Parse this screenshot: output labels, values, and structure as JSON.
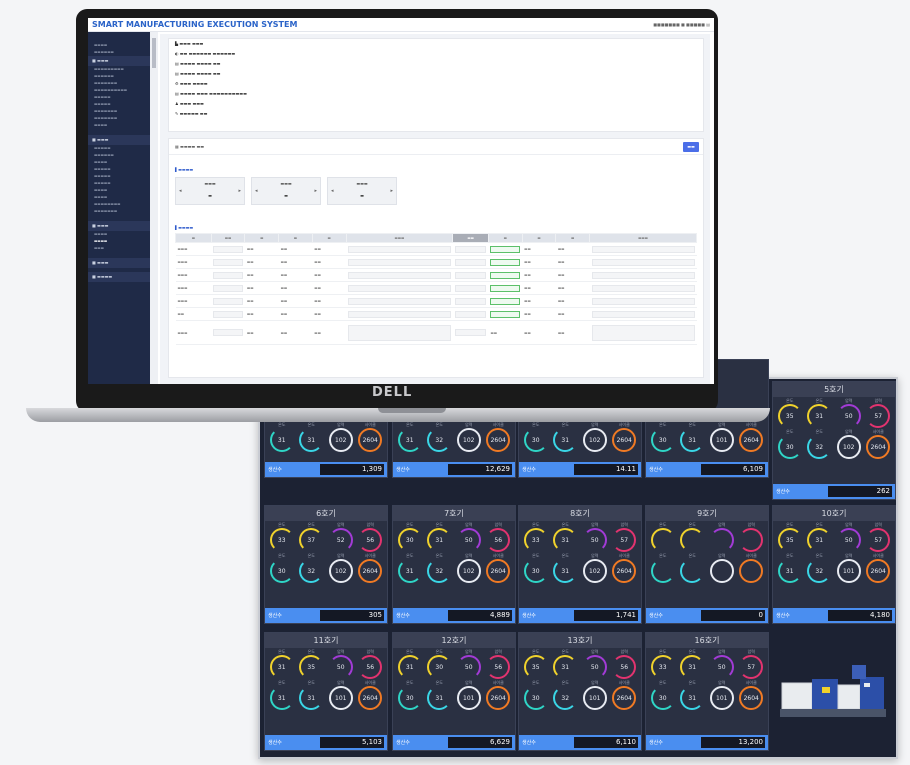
{
  "app": {
    "title": "SMART MANUFACTURING EXECUTION SYSTEM"
  },
  "laptop": {
    "brand": "DELL"
  },
  "machines": [
    {
      "name": "5호기",
      "top": [
        "35",
        "31",
        "50",
        "57"
      ],
      "bottom": [
        "30",
        "32",
        "102",
        "2604"
      ],
      "production": "262"
    },
    {
      "name": "6호기",
      "top": [
        "33",
        "37",
        "52",
        "56"
      ],
      "bottom": [
        "30",
        "32",
        "102",
        "2604"
      ],
      "production": "305"
    },
    {
      "name": "7호기",
      "top": [
        "30",
        "31",
        "50",
        "56"
      ],
      "bottom": [
        "31",
        "32",
        "102",
        "2604"
      ],
      "production": "4,889"
    },
    {
      "name": "8호기",
      "top": [
        "33",
        "31",
        "50",
        "57"
      ],
      "bottom": [
        "30",
        "31",
        "102",
        "2604"
      ],
      "production": "1,741"
    },
    {
      "name": "9호기",
      "top": [
        "",
        "",
        "",
        ""
      ],
      "bottom": [
        "",
        "",
        "",
        ""
      ],
      "production": "0"
    },
    {
      "name": "10호기",
      "top": [
        "35",
        "31",
        "50",
        "57"
      ],
      "bottom": [
        "31",
        "32",
        "101",
        "2604"
      ],
      "production": "4,180"
    },
    {
      "name": "11호기",
      "top": [
        "31",
        "35",
        "50",
        "56"
      ],
      "bottom": [
        "31",
        "31",
        "101",
        "2604"
      ],
      "production": "5,103"
    },
    {
      "name": "12호기",
      "top": [
        "31",
        "30",
        "50",
        "56"
      ],
      "bottom": [
        "30",
        "31",
        "101",
        "2604"
      ],
      "production": "6,629"
    },
    {
      "name": "13호기",
      "top": [
        "35",
        "31",
        "50",
        "56"
      ],
      "bottom": [
        "30",
        "32",
        "101",
        "2604"
      ],
      "production": "6,110"
    },
    {
      "name": "16호기",
      "top": [
        "33",
        "31",
        "50",
        "57"
      ],
      "bottom": [
        "30",
        "31",
        "101",
        "2604"
      ],
      "production": "13,200"
    }
  ],
  "partial_row": [
    {
      "bottom": [
        "31",
        "31",
        "102",
        "2604"
      ],
      "production": "1,309"
    },
    {
      "bottom": [
        "31",
        "32",
        "102",
        "2604"
      ],
      "production": "12,629"
    },
    {
      "bottom": [
        "30",
        "31",
        "102",
        "2604"
      ],
      "production": "14.11"
    },
    {
      "bottom": [
        "30",
        "31",
        "101",
        "2604"
      ],
      "production": "6,109"
    }
  ],
  "production_label": "생산수"
}
